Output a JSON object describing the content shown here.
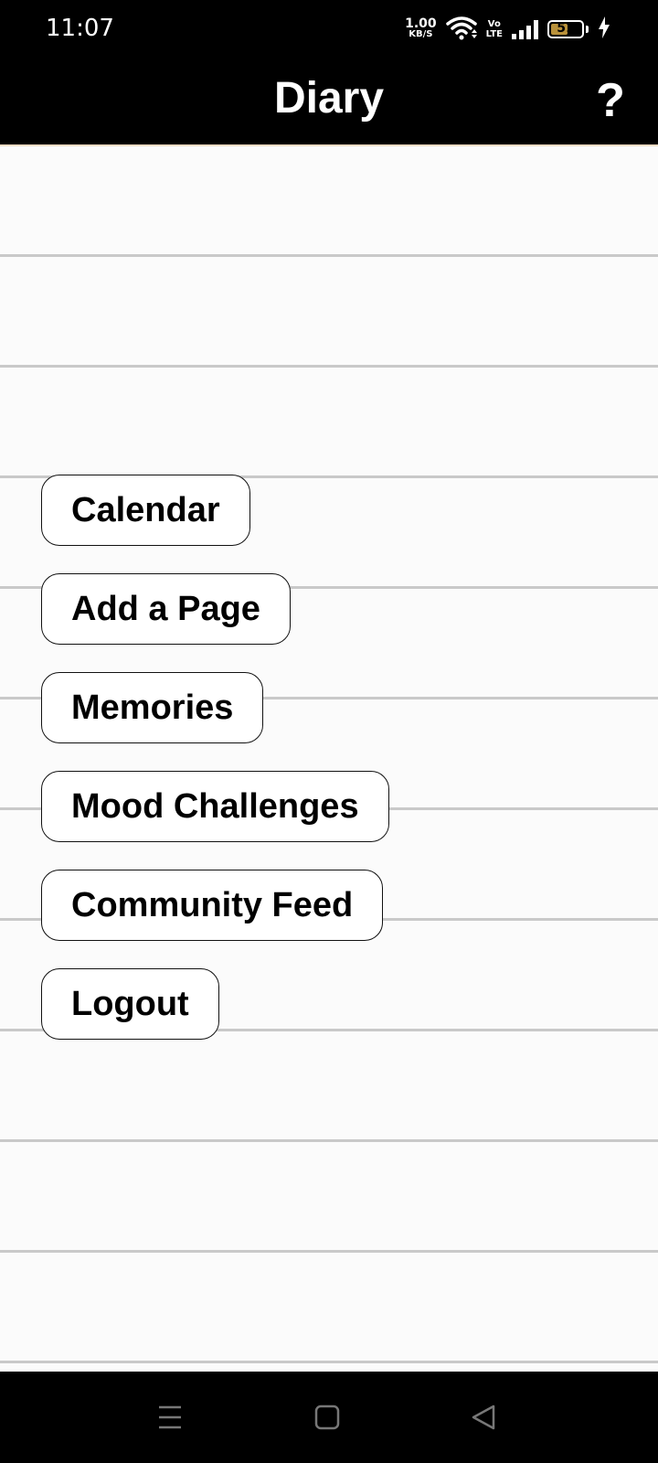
{
  "status_bar": {
    "time": "11:07",
    "net_speed_value": "1.00",
    "net_speed_unit": "KB/S",
    "volte_top": "Vo",
    "volte_bottom": "LTE",
    "battery_level": "51",
    "icons": [
      "wifi-icon",
      "signal-icon",
      "battery-icon",
      "charging-icon"
    ]
  },
  "app_bar": {
    "title": "Diary",
    "help_label": "?"
  },
  "menu": {
    "items": [
      {
        "label": "Calendar"
      },
      {
        "label": "Add a Page"
      },
      {
        "label": "Memories"
      },
      {
        "label": "Mood Challenges"
      },
      {
        "label": "Community Feed"
      },
      {
        "label": "Logout"
      }
    ]
  },
  "nav_bar": {
    "icons": [
      "menu-icon",
      "home-icon",
      "back-icon"
    ]
  },
  "colors": {
    "bar_background": "#000000",
    "page_background": "#fbfbfb",
    "rule_line": "#c9c9c9",
    "battery_fill": "#b9913a"
  }
}
